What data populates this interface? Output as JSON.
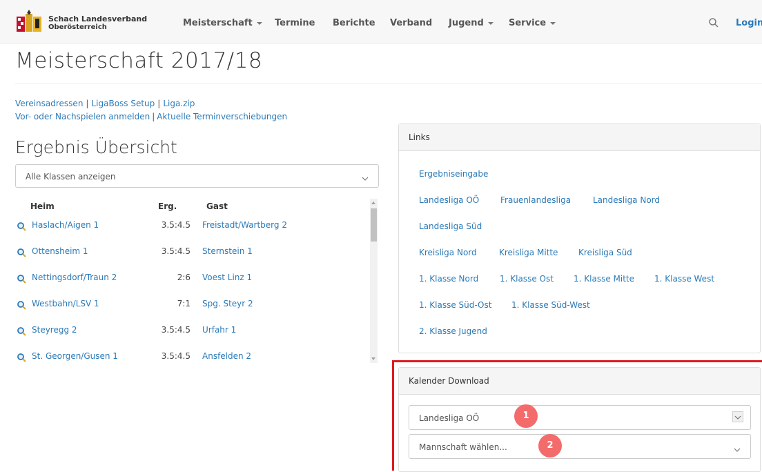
{
  "brand": {
    "line1": "Schach Landesverband",
    "line2": "Oberösterreich"
  },
  "nav": {
    "items": [
      {
        "label": "Meisterschaft",
        "dropdown": true
      },
      {
        "label": "Termine",
        "dropdown": false
      },
      {
        "label": "Berichte",
        "dropdown": false
      },
      {
        "label": "Verband",
        "dropdown": false
      },
      {
        "label": "Jugend",
        "dropdown": true
      },
      {
        "label": "Service",
        "dropdown": true
      }
    ],
    "login": "Login"
  },
  "page": {
    "title": "Meisterschaft 2017/18",
    "quicklinks_row1": [
      "Vereinsadressen",
      "LigaBoss Setup",
      "Liga.zip"
    ],
    "quicklinks_row2": [
      "Vor- oder Nachspielen anmelden",
      "Aktuelle Terminverschiebungen"
    ],
    "separator": "|"
  },
  "results": {
    "title": "Ergebnis Übersicht",
    "filter_value": "Alle Klassen anzeigen",
    "headers": {
      "home": "Heim",
      "result": "Erg.",
      "guest": "Gast"
    },
    "rows": [
      {
        "home": "Haslach/Aigen 1",
        "result": "3.5:4.5",
        "guest": "Freistadt/Wartberg 2"
      },
      {
        "home": "Ottensheim 1",
        "result": "3.5:4.5",
        "guest": "Sternstein 1"
      },
      {
        "home": "Nettingsdorf/Traun 2",
        "result": "2:6",
        "guest": "Voest Linz 1"
      },
      {
        "home": "Westbahn/LSV 1",
        "result": "7:1",
        "guest": "Spg. Steyr 2"
      },
      {
        "home": "Steyregg 2",
        "result": "3.5:4.5",
        "guest": "Urfahr 1"
      },
      {
        "home": "St. Georgen/Gusen 1",
        "result": "3.5:4.5",
        "guest": "Ansfelden 2"
      }
    ]
  },
  "links_panel": {
    "title": "Links",
    "rows": [
      [
        "Ergebniseingabe"
      ],
      [
        "Landesliga OÖ",
        "Frauenlandesliga",
        "Landesliga Nord"
      ],
      [
        "Landesliga Süd"
      ],
      [
        "Kreisliga Nord",
        "Kreisliga Mitte",
        "Kreisliga Süd"
      ],
      [
        "1. Klasse Nord",
        "1. Klasse Ost",
        "1. Klasse Mitte",
        "1. Klasse West"
      ],
      [
        "1. Klasse Süd-Ost",
        "1. Klasse Süd-West"
      ],
      [
        "2. Klasse Jugend"
      ]
    ]
  },
  "calendar_panel": {
    "title": "Kalender Download",
    "league_value": "Landesliga OÖ",
    "team_placeholder": "Mannschaft wählen...",
    "marker1": "1",
    "marker2": "2"
  },
  "colors": {
    "link": "#2a7ab8",
    "highlight": "#e0191f",
    "marker": "#f36b6b"
  }
}
